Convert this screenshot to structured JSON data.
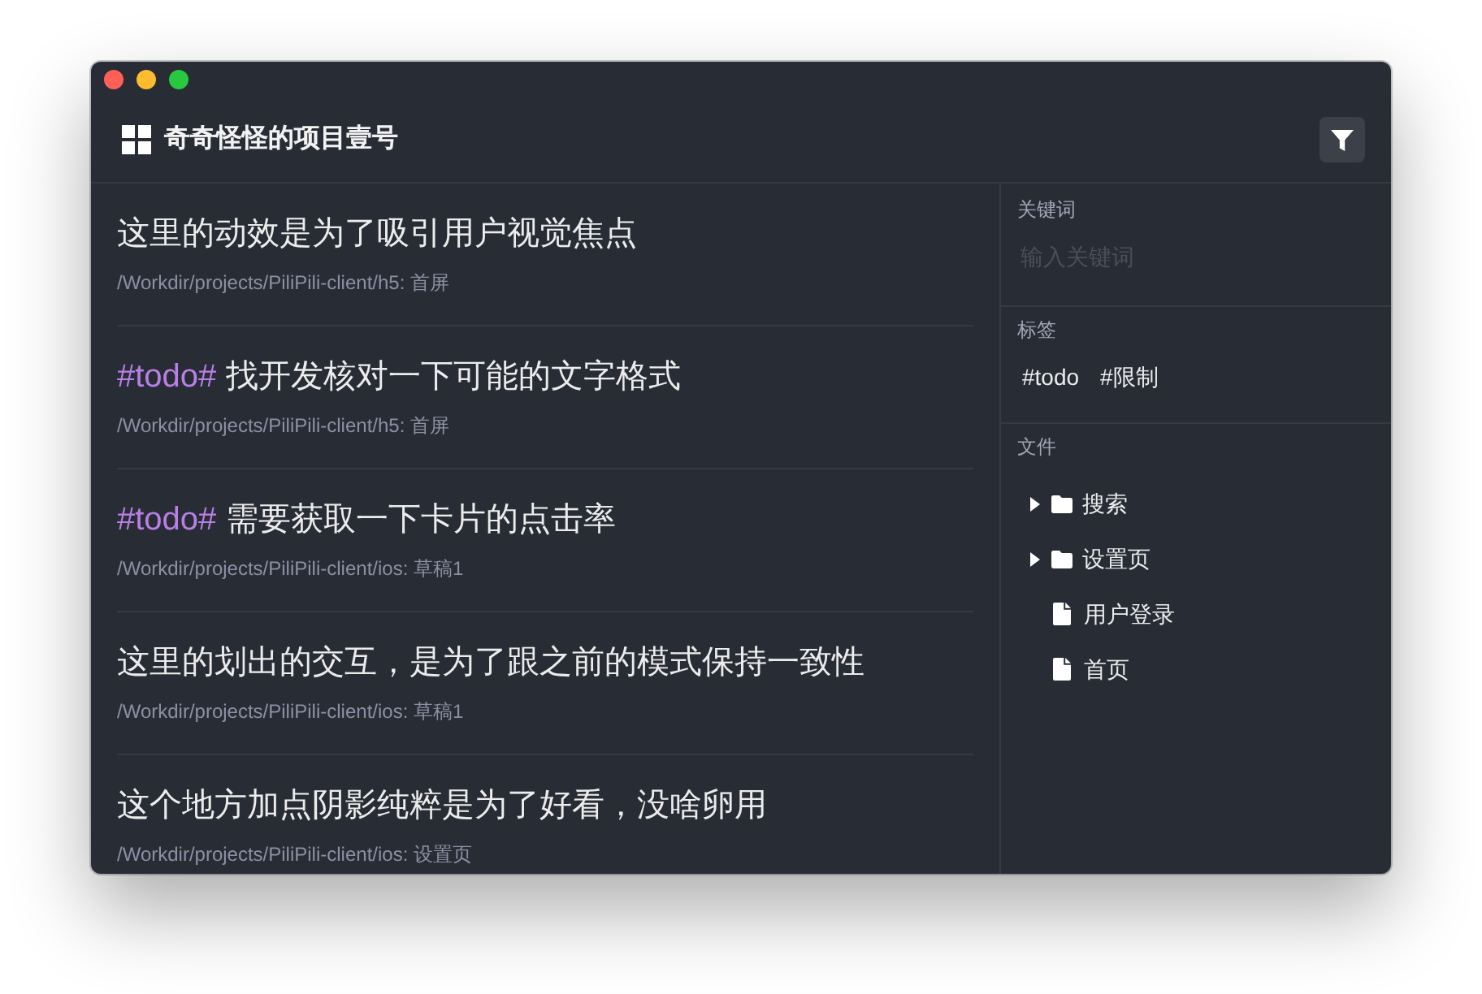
{
  "app": {
    "title": "奇奇怪怪的项目壹号"
  },
  "notes": [
    {
      "title": "这里的动效是为了吸引用户视觉焦点",
      "path": "/Workdir/projects/PiliPili-client/h5: 首屏"
    },
    {
      "tag": "#todo#",
      "title": "找开发核对一下可能的文字格式",
      "path": "/Workdir/projects/PiliPili-client/h5: 首屏"
    },
    {
      "tag": "#todo#",
      "title": "需要获取一下卡片的点击率",
      "path": "/Workdir/projects/PiliPili-client/ios: 草稿1"
    },
    {
      "title": "这里的划出的交互，是为了跟之前的模式保持一致性",
      "path": "/Workdir/projects/PiliPili-client/ios: 草稿1"
    },
    {
      "title": "这个地方加点阴影纯粹是为了好看，没啥卵用",
      "path": "/Workdir/projects/PiliPili-client/ios: 设置页"
    }
  ],
  "filters": {
    "keyword": {
      "label": "关键词",
      "placeholder": "输入关键词"
    },
    "tags": {
      "label": "标签",
      "items": [
        "#todo",
        "#限制"
      ]
    },
    "files": {
      "label": "文件",
      "tree": [
        {
          "kind": "folder",
          "name": "搜索",
          "expanded": false
        },
        {
          "kind": "folder",
          "name": "设置页",
          "expanded": false
        },
        {
          "kind": "file",
          "name": "用户登录"
        },
        {
          "kind": "file",
          "name": "首页"
        }
      ]
    }
  }
}
